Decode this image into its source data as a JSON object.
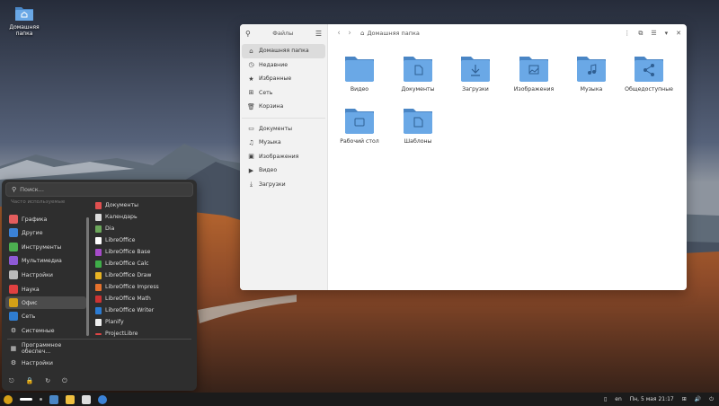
{
  "desktop": {
    "home_icon_label": "Домашняя папка"
  },
  "file_manager": {
    "sidebar_title": "Файлы",
    "sidebar_items": [
      {
        "label": "Домашняя папка",
        "icon": "home-icon",
        "active": true
      },
      {
        "label": "Недавние",
        "icon": "clock-icon"
      },
      {
        "label": "Избранные",
        "icon": "star-icon"
      },
      {
        "label": "Сеть",
        "icon": "network-icon"
      },
      {
        "label": "Корзина",
        "icon": "trash-icon"
      }
    ],
    "sidebar_places": [
      {
        "label": "Документы",
        "icon": "document-icon"
      },
      {
        "label": "Музыка",
        "icon": "music-icon"
      },
      {
        "label": "Изображения",
        "icon": "image-icon"
      },
      {
        "label": "Видео",
        "icon": "video-icon"
      },
      {
        "label": "Загрузки",
        "icon": "download-icon"
      }
    ],
    "path": "Домашняя папка",
    "folders": [
      {
        "label": "Видео",
        "glyph": ""
      },
      {
        "label": "Документы",
        "glyph": "doc"
      },
      {
        "label": "Загрузки",
        "glyph": "download"
      },
      {
        "label": "Изображения",
        "glyph": "image"
      },
      {
        "label": "Музыка",
        "glyph": "music"
      },
      {
        "label": "Общедоступные",
        "glyph": "share"
      },
      {
        "label": "Рабочий стол",
        "glyph": "desktop"
      },
      {
        "label": "Шаблоны",
        "glyph": "template"
      }
    ],
    "colors": {
      "folder": "#5b9bd5",
      "folder_tab": "#4a86c5"
    }
  },
  "start_menu": {
    "search_placeholder": "Поиск...",
    "faded_item": "Часто используемые",
    "categories": [
      {
        "label": "Графика",
        "color": "#e35d5d"
      },
      {
        "label": "Другие",
        "color": "#3b82d6"
      },
      {
        "label": "Инструменты",
        "color": "#4caf50"
      },
      {
        "label": "Мультимедиа",
        "color": "#8e5ad6"
      },
      {
        "label": "Настройки",
        "color": "#bbbbbb"
      },
      {
        "label": "Наука",
        "color": "#e04040"
      },
      {
        "label": "Офис",
        "color": "#d4a017",
        "active": true
      },
      {
        "label": "Сеть",
        "color": "#2f7dd1"
      },
      {
        "label": "Системные",
        "color": "#dddddd"
      }
    ],
    "bottom_items": [
      {
        "label": "Программное обеспеч...",
        "color": "#dddddd"
      },
      {
        "label": "Настройки",
        "color": "#dddddd"
      }
    ],
    "apps": [
      {
        "label": "Документы",
        "color": "#e05050"
      },
      {
        "label": "Календарь",
        "color": "#dddddd"
      },
      {
        "label": "Dia",
        "color": "#6ca75b"
      },
      {
        "label": "LibreOffice",
        "color": "#ffffff"
      },
      {
        "label": "LibreOffice Base",
        "color": "#a64bc9"
      },
      {
        "label": "LibreOffice Calc",
        "color": "#3fae49"
      },
      {
        "label": "LibreOffice Draw",
        "color": "#e8b323"
      },
      {
        "label": "LibreOffice Impress",
        "color": "#e6722d"
      },
      {
        "label": "LibreOffice Math",
        "color": "#c33"
      },
      {
        "label": "LibreOffice Writer",
        "color": "#2b7bd3"
      },
      {
        "label": "Planify",
        "color": "#eeeeee"
      },
      {
        "label": "ProjectLibre",
        "color": "#e04545"
      }
    ]
  },
  "taskbar": {
    "lang": "en",
    "clock": "Пн, 5 мая  21:17"
  }
}
